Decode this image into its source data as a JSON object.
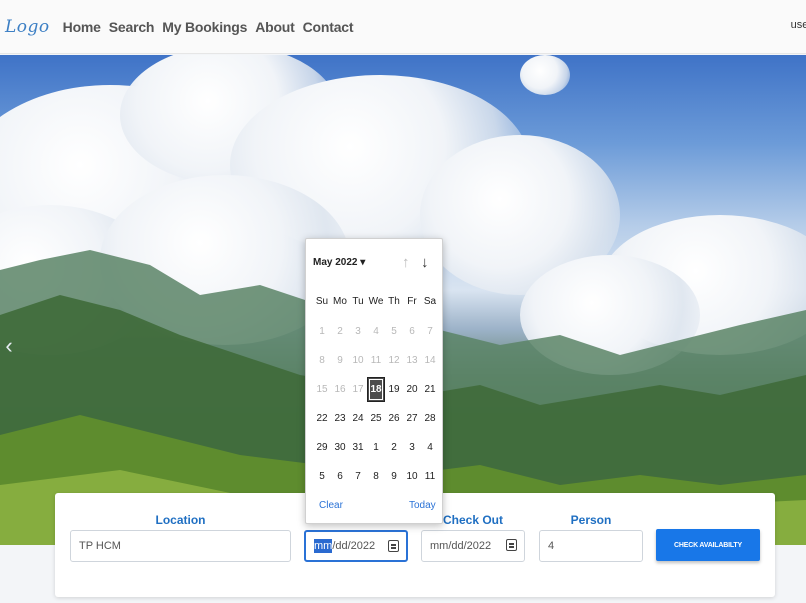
{
  "navbar": {
    "logo": "Logo",
    "links": [
      "Home",
      "Search",
      "My Bookings",
      "About",
      "Contact"
    ],
    "user": "userC"
  },
  "hero": {
    "carousel_prev_icon": "chevron-left-icon"
  },
  "search": {
    "location_label": "Location",
    "location_value": "TP HCM",
    "checkin_value_selected": "mm",
    "checkin_value_rest": "/dd/2022",
    "checkout_label": "Check Out",
    "checkout_value": "mm/dd/2022",
    "person_label": "Person",
    "person_value": "4",
    "button_label": "CHECK AVAILABILTY"
  },
  "datepicker": {
    "month_label": "May 2022 ▾",
    "weekdays": [
      "Su",
      "Mo",
      "Tu",
      "We",
      "Th",
      "Fr",
      "Sa"
    ],
    "days": [
      {
        "d": "1",
        "off": true
      },
      {
        "d": "2",
        "off": true
      },
      {
        "d": "3",
        "off": true
      },
      {
        "d": "4",
        "off": true
      },
      {
        "d": "5",
        "off": true
      },
      {
        "d": "6",
        "off": true
      },
      {
        "d": "7",
        "off": true
      },
      {
        "d": "8",
        "off": true
      },
      {
        "d": "9",
        "off": true
      },
      {
        "d": "10",
        "off": true
      },
      {
        "d": "11",
        "off": true
      },
      {
        "d": "12",
        "off": true
      },
      {
        "d": "13",
        "off": true
      },
      {
        "d": "14",
        "off": true
      },
      {
        "d": "15",
        "off": true
      },
      {
        "d": "16",
        "off": true
      },
      {
        "d": "17",
        "off": true
      },
      {
        "d": "18",
        "today": true
      },
      {
        "d": "19"
      },
      {
        "d": "20"
      },
      {
        "d": "21"
      },
      {
        "d": "22"
      },
      {
        "d": "23"
      },
      {
        "d": "24"
      },
      {
        "d": "25"
      },
      {
        "d": "26"
      },
      {
        "d": "27"
      },
      {
        "d": "28"
      },
      {
        "d": "29"
      },
      {
        "d": "30"
      },
      {
        "d": "31"
      },
      {
        "d": "1"
      },
      {
        "d": "2"
      },
      {
        "d": "3"
      },
      {
        "d": "4"
      },
      {
        "d": "5"
      },
      {
        "d": "6"
      },
      {
        "d": "7"
      },
      {
        "d": "8"
      },
      {
        "d": "9"
      },
      {
        "d": "10"
      },
      {
        "d": "11"
      }
    ],
    "clear_label": "Clear",
    "today_label": "Today"
  }
}
